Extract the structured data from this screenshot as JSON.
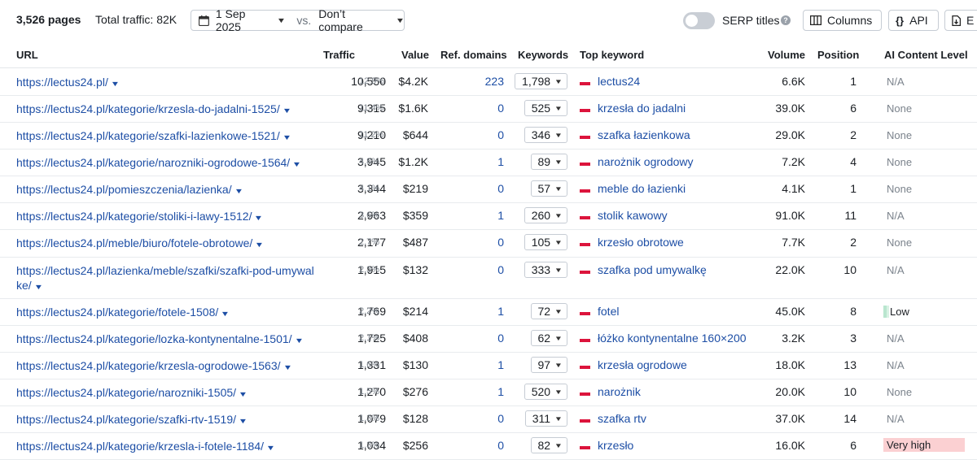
{
  "summary": {
    "pages": "3,526 pages",
    "total_traffic": "Total traffic: 82K"
  },
  "date_picker": {
    "date": "1 Sep 2025",
    "vs": "vs.",
    "compare": "Don’t compare"
  },
  "toolbar": {
    "serp_titles": "SERP titles",
    "help": "?",
    "columns": "Columns",
    "api_icon": "{}",
    "api": "API",
    "export": "E"
  },
  "columns": {
    "url": "URL",
    "traffic": "Traffic",
    "value": "Value",
    "ref_domains": "Ref. domains",
    "keywords": "Keywords",
    "top_keyword": "Top keyword",
    "volume": "Volume",
    "position": "Position",
    "ai_content_level": "AI Content Level"
  },
  "colors": {
    "link": "#1d4ea5",
    "flag_top": "#ffffff",
    "flag_bottom": "#dc143c",
    "ai_low": "#d8f2e4",
    "ai_very_high": "#fbd0d2"
  },
  "rows": [
    {
      "url": "https://lectus24.pl/",
      "traffic": "10,550",
      "traffic_pct": "12.9%",
      "value": "$4.2K",
      "ref_domains": "223",
      "keywords": "1,798",
      "top_keyword": "lectus24",
      "volume": "6.6K",
      "position": "1",
      "ai": "N/A"
    },
    {
      "url": "https://lectus24.pl/kategorie/krzesla-do-jadalni-1525/",
      "traffic": "9,315",
      "traffic_pct": "11.4%",
      "value": "$1.6K",
      "ref_domains": "0",
      "keywords": "525",
      "top_keyword": "krzesła do jadalni",
      "volume": "39.0K",
      "position": "6",
      "ai": "None"
    },
    {
      "url": "https://lectus24.pl/kategorie/szafki-lazienkowe-1521/",
      "traffic": "9,210",
      "traffic_pct": "11.2%",
      "value": "$644",
      "ref_domains": "0",
      "keywords": "346",
      "top_keyword": "szafka łazienkowa",
      "volume": "29.0K",
      "position": "2",
      "ai": "None"
    },
    {
      "url": "https://lectus24.pl/kategorie/narozniki-ogrodowe-1564/",
      "traffic": "3,945",
      "traffic_pct": "4.8%",
      "value": "$1.2K",
      "ref_domains": "1",
      "keywords": "89",
      "top_keyword": "narożnik ogrodowy",
      "volume": "7.2K",
      "position": "4",
      "ai": "None"
    },
    {
      "url": "https://lectus24.pl/pomieszczenia/lazienka/",
      "traffic": "3,344",
      "traffic_pct": "4.1%",
      "value": "$219",
      "ref_domains": "0",
      "keywords": "57",
      "top_keyword": "meble do łazienki",
      "volume": "4.1K",
      "position": "1",
      "ai": "None"
    },
    {
      "url": "https://lectus24.pl/kategorie/stoliki-i-lawy-1512/",
      "traffic": "2,963",
      "traffic_pct": "3.6%",
      "value": "$359",
      "ref_domains": "1",
      "keywords": "260",
      "top_keyword": "stolik kawowy",
      "volume": "91.0K",
      "position": "11",
      "ai": "N/A"
    },
    {
      "url": "https://lectus24.pl/meble/biuro/fotele-obrotowe/",
      "traffic": "2,177",
      "traffic_pct": "2.7%",
      "value": "$487",
      "ref_domains": "0",
      "keywords": "105",
      "top_keyword": "krzesło obrotowe",
      "volume": "7.7K",
      "position": "2",
      "ai": "None"
    },
    {
      "url": "https://lectus24.pl/lazienka/meble/szafki/szafki-pod-umywalke/",
      "traffic": "1,915",
      "traffic_pct": "2.3%",
      "value": "$132",
      "ref_domains": "0",
      "keywords": "333",
      "top_keyword": "szafka pod umywalkę",
      "volume": "22.0K",
      "position": "10",
      "ai": "N/A"
    },
    {
      "url": "https://lectus24.pl/kategorie/fotele-1508/",
      "traffic": "1,769",
      "traffic_pct": "2.2%",
      "value": "$214",
      "ref_domains": "1",
      "keywords": "72",
      "top_keyword": "fotel",
      "volume": "45.0K",
      "position": "8",
      "ai": "Low"
    },
    {
      "url": "https://lectus24.pl/kategorie/lozka-kontynentalne-1501/",
      "traffic": "1,725",
      "traffic_pct": "2.1%",
      "value": "$408",
      "ref_domains": "0",
      "keywords": "62",
      "top_keyword": "łóżko kontynentalne 160×200",
      "volume": "3.2K",
      "position": "3",
      "ai": "N/A"
    },
    {
      "url": "https://lectus24.pl/kategorie/krzesla-ogrodowe-1563/",
      "traffic": "1,331",
      "traffic_pct": "1.6%",
      "value": "$130",
      "ref_domains": "1",
      "keywords": "97",
      "top_keyword": "krzesła ogrodowe",
      "volume": "18.0K",
      "position": "13",
      "ai": "N/A"
    },
    {
      "url": "https://lectus24.pl/kategorie/narozniki-1505/",
      "traffic": "1,270",
      "traffic_pct": "1.5%",
      "value": "$276",
      "ref_domains": "1",
      "keywords": "520",
      "top_keyword": "narożnik",
      "volume": "20.0K",
      "position": "10",
      "ai": "None"
    },
    {
      "url": "https://lectus24.pl/kategorie/szafki-rtv-1519/",
      "traffic": "1,079",
      "traffic_pct": "1.3%",
      "value": "$128",
      "ref_domains": "0",
      "keywords": "311",
      "top_keyword": "szafka rtv",
      "volume": "37.0K",
      "position": "14",
      "ai": "N/A"
    },
    {
      "url": "https://lectus24.pl/kategorie/krzesla-i-fotele-1184/",
      "traffic": "1,034",
      "traffic_pct": "1.3%",
      "value": "$256",
      "ref_domains": "0",
      "keywords": "82",
      "top_keyword": "krzesło",
      "volume": "16.0K",
      "position": "6",
      "ai": "Very high"
    }
  ]
}
